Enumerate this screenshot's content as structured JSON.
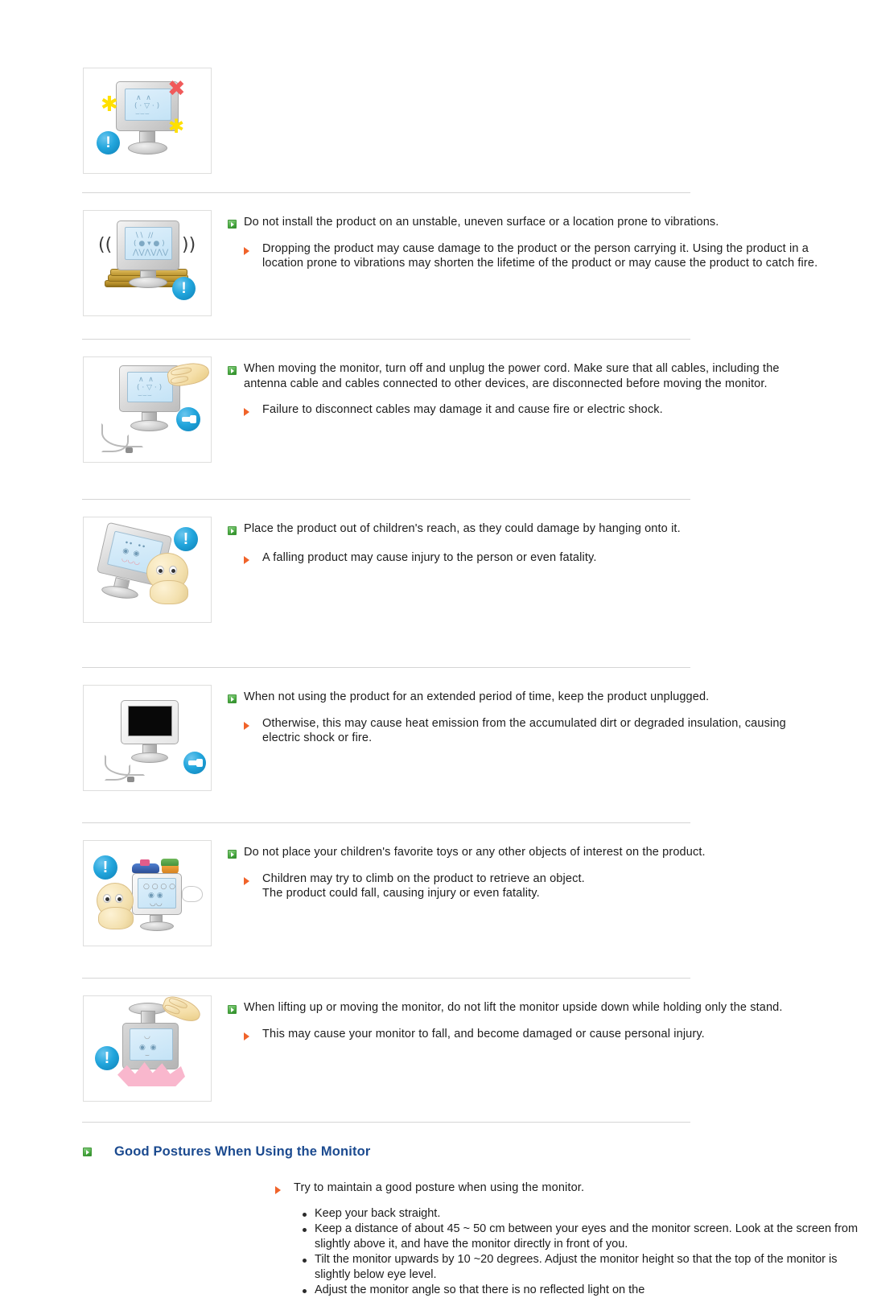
{
  "document": {
    "heading": {
      "text": "Good Postures When Using the Monitor"
    },
    "sections": [
      {
        "id": "sparkle-clean",
        "figure_alt": "Monitor with sparkles, red X and blue warning icon",
        "notices": []
      },
      {
        "id": "unstable-surface",
        "figure_alt": "Monitor shaking on a stack of books with blue warning icon",
        "notices": [
          {
            "type": "primary",
            "text": "Do not install the product on an unstable, uneven surface or a location prone to vibrations."
          },
          {
            "type": "secondary",
            "text": "Dropping the product may cause damage to the product or the person carrying it. Using the product in a location prone to vibrations may shorten the lifetime of the product or may cause the product to catch fire."
          }
        ]
      },
      {
        "id": "moving-monitor",
        "figure_alt": "Hand unplugging cable from monitor with blue plug icon",
        "notices": [
          {
            "type": "primary",
            "text": "When moving the monitor, turn off and unplug the power cord. Make sure that all cables, including the antenna cable and cables connected to other devices, are disconnected before moving the monitor."
          },
          {
            "type": "secondary",
            "text": "Failure to disconnect cables may damage it and cause fire or electric shock."
          }
        ]
      },
      {
        "id": "children-reach",
        "figure_alt": "Baby pulling a tilting monitor with blue warning icon",
        "notices": [
          {
            "type": "primary",
            "text": "Place the product out of children's reach, as they could damage by hanging onto it."
          },
          {
            "type": "secondary",
            "text": "A falling product may cause injury to the person or even fatality."
          }
        ]
      },
      {
        "id": "extended-unplug",
        "figure_alt": "Monitor turned off with unplugged power cable and blue plug icon",
        "notices": [
          {
            "type": "primary",
            "text": "When not using the product for an extended period of time, keep the product unplugged."
          },
          {
            "type": "secondary",
            "text": "Otherwise, this may cause heat emission from the accumulated dirt or degraded insulation, causing electric shock or fire."
          }
        ]
      },
      {
        "id": "toys-on-product",
        "figure_alt": "Baby reaching for toys placed on top of a monitor with blue warning icon",
        "notices": [
          {
            "type": "primary",
            "text": "Do not place your children's favorite toys or any other objects of interest on the product."
          },
          {
            "type": "secondary",
            "text": "Children may try to climb on the product to retrieve an object.\nThe product could fall, causing injury or even fatality."
          }
        ]
      },
      {
        "id": "lifting-upside-down",
        "figure_alt": "Monitor held upside down by the stand falling, with blue warning icon",
        "notices": [
          {
            "type": "primary",
            "text": "When lifting up or moving the monitor, do not lift the monitor upside down while holding only the stand."
          },
          {
            "type": "secondary",
            "text": "This may cause your monitor to fall, and become damaged or cause personal injury."
          }
        ]
      }
    ],
    "posture": {
      "intro": "Try to maintain a good posture when using the monitor.",
      "items": [
        "Keep your back straight.",
        "Keep a distance of about 45 ~ 50 cm between your eyes and the monitor screen. Look at the screen from slightly above it, and have the monitor directly in front of you.",
        "Tilt the monitor upwards by 10 ~20 degrees. Adjust the monitor height so that the top of the monitor is slightly below eye level.",
        "Adjust the monitor angle so that there is no reflected light on the"
      ]
    },
    "icons": {
      "primary_bullet": "green-square-play-icon",
      "secondary_bullet": "orange-arrow-icon",
      "list_bullet": "round-dot-icon",
      "warning": "blue-exclamation-icon",
      "plug": "blue-plug-icon"
    },
    "colors": {
      "heading": "#1b4a8f",
      "primary_bullet": "#4fae46",
      "secondary_bullet": "#f0632a",
      "divider": "#d5d5d5",
      "warning_icon": "#22a6dd"
    }
  }
}
